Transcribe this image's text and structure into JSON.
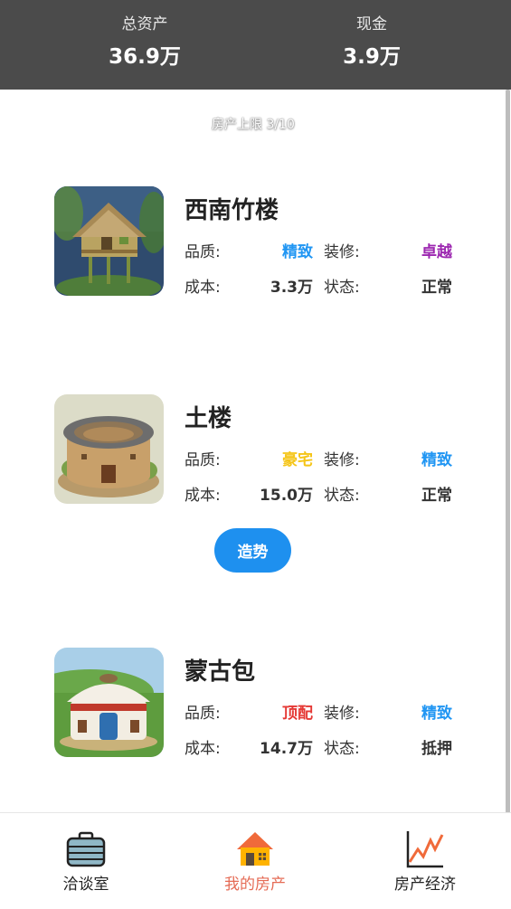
{
  "header": {
    "total_assets_label": "总资产",
    "total_assets_value": "36.9万",
    "cash_label": "现金",
    "cash_value": "3.9万"
  },
  "property_limit": "房产上限 3/10",
  "properties": [
    {
      "name": "西南竹楼",
      "quality_label": "品质:",
      "quality_value": "精致",
      "quality_color": "#2196f3",
      "decor_label": "装修:",
      "decor_value": "卓越",
      "decor_color": "#9c27b0",
      "cost_label": "成本:",
      "cost_value": "3.3万",
      "status_label": "状态:",
      "status_value": "正常",
      "image_icon": "bamboo-house-image"
    },
    {
      "name": "土楼",
      "quality_label": "品质:",
      "quality_value": "豪宅",
      "quality_color": "#f5c518",
      "decor_label": "装修:",
      "decor_value": "精致",
      "decor_color": "#2196f3",
      "cost_label": "成本:",
      "cost_value": "15.0万",
      "status_label": "状态:",
      "status_value": "正常",
      "image_icon": "tulou-image",
      "action_label": "造势"
    },
    {
      "name": "蒙古包",
      "quality_label": "品质:",
      "quality_value": "顶配",
      "quality_color": "#e53935",
      "decor_label": "装修:",
      "decor_value": "精致",
      "decor_color": "#2196f3",
      "cost_label": "成本:",
      "cost_value": "14.7万",
      "status_label": "状态:",
      "status_value": "抵押",
      "image_icon": "yurt-image"
    }
  ],
  "nav": [
    {
      "label": "洽谈室",
      "icon": "briefcase-icon",
      "active": false
    },
    {
      "label": "我的房产",
      "icon": "house-icon",
      "active": true
    },
    {
      "label": "房产经济",
      "icon": "line-chart-icon",
      "active": false
    }
  ],
  "colors": {
    "header_bg": "#4b4b4b",
    "accent_blue": "#1e90ef",
    "active_nav": "#e56b55"
  }
}
